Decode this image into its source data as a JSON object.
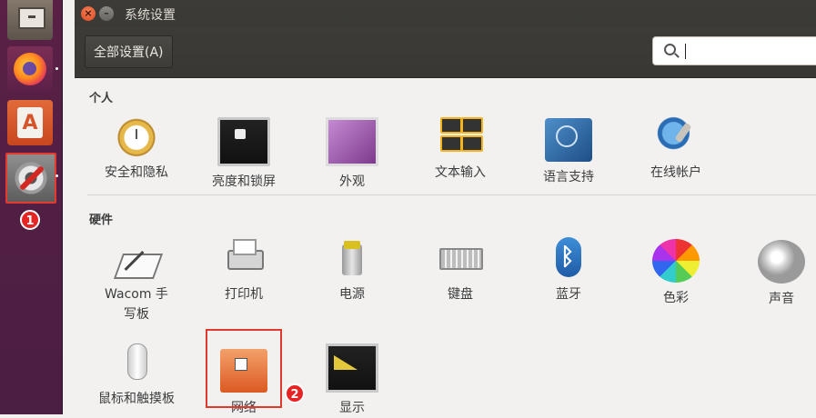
{
  "launcher": {
    "items": [
      {
        "name": "files",
        "icon": "file-cabinet-icon"
      },
      {
        "name": "firefox",
        "icon": "firefox-icon"
      },
      {
        "name": "software-center",
        "icon": "shopping-bag-icon"
      },
      {
        "name": "system-settings",
        "icon": "settings-gear-wrench-icon",
        "highlighted": true
      }
    ]
  },
  "annotations": {
    "badge1": "1",
    "badge2": "2",
    "highlight_color": "#e03a2f",
    "badge_color": "#e62424"
  },
  "window": {
    "title": "系统设置",
    "close_symbol": "×",
    "min_symbol": "–",
    "toolbar": {
      "all_settings_label": "全部设置(A)",
      "search_placeholder": "",
      "search_value": ""
    }
  },
  "sections": {
    "personal": {
      "title": "个人",
      "items": [
        {
          "label": "安全和隐私",
          "icon": "clock-lock-icon"
        },
        {
          "label": "亮度和锁屏",
          "icon": "monitor-lock-icon"
        },
        {
          "label": "外观",
          "icon": "appearance-icon"
        },
        {
          "label": "文本输入",
          "icon": "keyboard-keys-icon"
        },
        {
          "label": "语言支持",
          "icon": "language-flag-icon"
        },
        {
          "label": "在线帐户",
          "icon": "online-accounts-icon"
        }
      ]
    },
    "hardware": {
      "title": "硬件",
      "items": [
        {
          "label": "Wacom 手写板",
          "icon": "wacom-tablet-icon"
        },
        {
          "label": "打印机",
          "icon": "printer-icon"
        },
        {
          "label": "电源",
          "icon": "battery-plug-icon"
        },
        {
          "label": "键盘",
          "icon": "keyboard-icon"
        },
        {
          "label": "蓝牙",
          "icon": "bluetooth-icon"
        },
        {
          "label": "色彩",
          "icon": "color-flower-icon"
        },
        {
          "label": "声音",
          "icon": "speaker-icon"
        },
        {
          "label": "鼠标和触摸板",
          "icon": "mouse-icon"
        },
        {
          "label": "网络",
          "icon": "network-folder-icon",
          "highlighted": true
        },
        {
          "label": "显示",
          "icon": "display-monitor-icon"
        }
      ]
    }
  }
}
